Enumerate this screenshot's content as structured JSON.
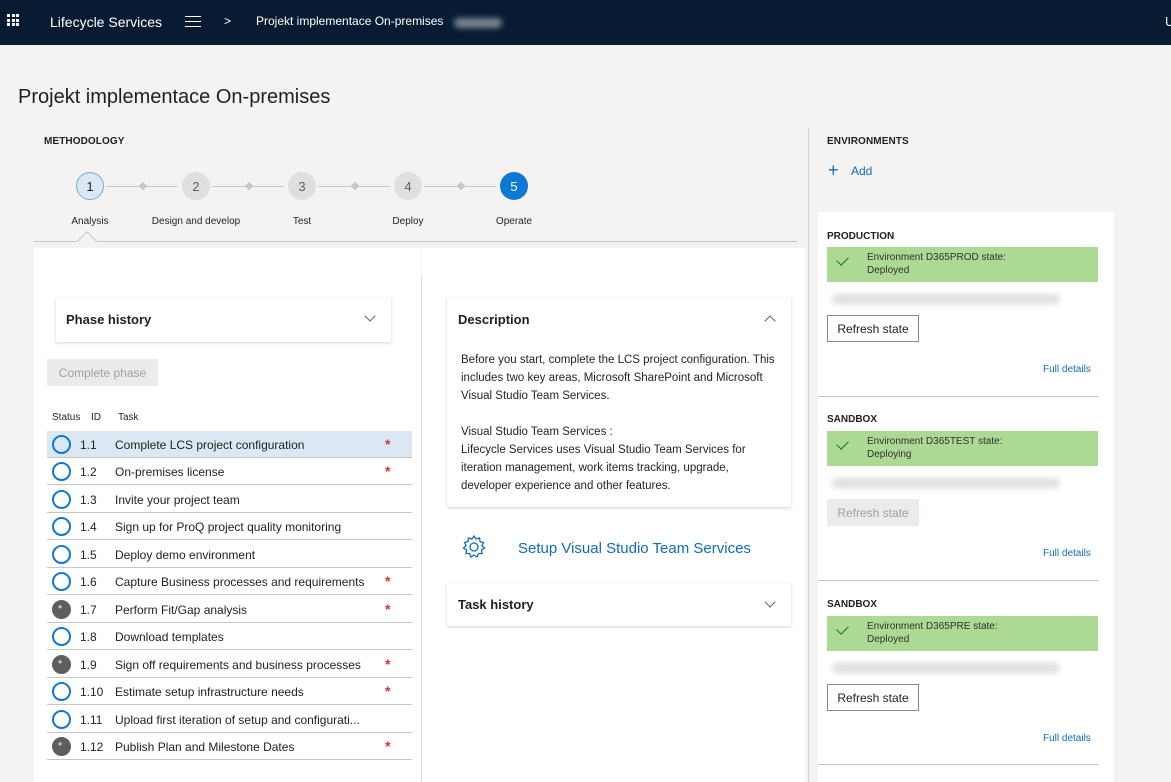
{
  "topbar": {
    "app_name": "Lifecycle Services",
    "crumb_separator": ">",
    "breadcrumb": "Projekt implementace On-premises",
    "edge_letter": "U"
  },
  "page_title": "Projekt implementace On-premises",
  "methodology": {
    "heading": "METHODOLOGY",
    "steps": [
      {
        "number": "1",
        "label": "Analysis",
        "state": "active"
      },
      {
        "number": "2",
        "label": "Design and develop",
        "state": "pending"
      },
      {
        "number": "3",
        "label": "Test",
        "state": "pending"
      },
      {
        "number": "4",
        "label": "Deploy",
        "state": "pending"
      },
      {
        "number": "5",
        "label": "Operate",
        "state": "current"
      }
    ]
  },
  "phase_history": {
    "title": "Phase history",
    "complete_phase_label": "Complete phase"
  },
  "task_table": {
    "headers": {
      "status": "Status",
      "id": "ID",
      "task": "Task"
    },
    "rows": [
      {
        "id": "1.1",
        "task": "Complete LCS project configuration",
        "status": "open",
        "required": true
      },
      {
        "id": "1.2",
        "task": "On-premises license",
        "status": "open",
        "required": true
      },
      {
        "id": "1.3",
        "task": "Invite your project team",
        "status": "open",
        "required": false
      },
      {
        "id": "1.4",
        "task": "Sign up for ProQ project quality monitoring",
        "status": "open",
        "required": false
      },
      {
        "id": "1.5",
        "task": "Deploy demo environment",
        "status": "open",
        "required": false
      },
      {
        "id": "1.6",
        "task": "Capture Business processes and requirements",
        "status": "open",
        "required": true
      },
      {
        "id": "1.7",
        "task": "Perform Fit/Gap analysis",
        "status": "in-progress",
        "required": true
      },
      {
        "id": "1.8",
        "task": "Download templates",
        "status": "open",
        "required": false
      },
      {
        "id": "1.9",
        "task": "Sign off requirements and business processes",
        "status": "in-progress",
        "required": true
      },
      {
        "id": "1.10",
        "task": "Estimate setup infrastructure needs",
        "status": "open",
        "required": true
      },
      {
        "id": "1.11",
        "task": "Upload first iteration of setup and configurati...",
        "status": "open",
        "required": false
      },
      {
        "id": "1.12",
        "task": "Publish Plan and Milestone Dates",
        "status": "in-progress",
        "required": true
      }
    ],
    "required_marker": "*"
  },
  "description": {
    "title": "Description",
    "paragraph1": "Before you start, complete the LCS project configuration. This includes two key areas, Microsoft SharePoint and Microsoft Visual Studio Team Services.",
    "paragraph2_heading": "Visual Studio Team Services :",
    "paragraph2": "Lifecycle Services uses Visual Studio Team Services  for iteration management, work items tracking, upgrade, developer experience and other features."
  },
  "setup_link": "Setup Visual Studio Team Services",
  "task_history": {
    "title": "Task history"
  },
  "environments": {
    "heading": "ENVIRONMENTS",
    "add_icon": "+",
    "add_label": "Add",
    "items": [
      {
        "type": "PRODUCTION",
        "status_line1": "Environment D365PROD state:",
        "status_line2": "Deployed",
        "refresh_label": "Refresh state",
        "refresh_enabled": true,
        "details_label": "Full details"
      },
      {
        "type": "SANDBOX",
        "status_line1": "Environment D365TEST state:",
        "status_line2": "Deploying",
        "refresh_label": "Refresh state",
        "refresh_enabled": false,
        "details_label": "Full details"
      },
      {
        "type": "SANDBOX",
        "status_line1": "Environment D365PRE state:",
        "status_line2": "Deployed",
        "refresh_label": "Refresh state",
        "refresh_enabled": true,
        "details_label": "Full details"
      }
    ]
  },
  "colors": {
    "topbar": "#071c33",
    "accent": "#0f78d4",
    "status_success": "#acd994",
    "required_star": "#d13438"
  }
}
